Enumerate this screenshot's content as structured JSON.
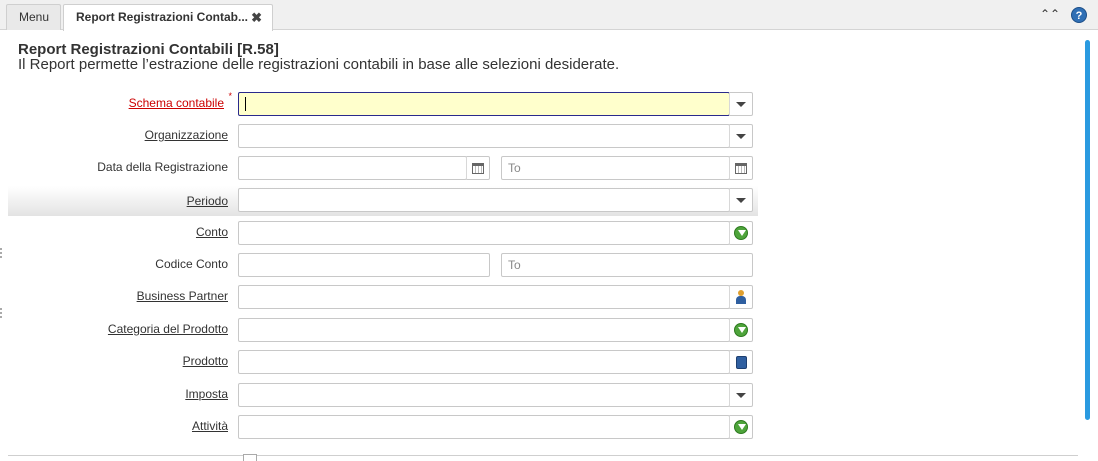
{
  "tabs": {
    "menu_label": "Menu",
    "active_label": "Report Registrazioni Contab...",
    "close_symbol": "✖"
  },
  "toolbar": {
    "collapse_symbol": "⌃⌃",
    "help_symbol": "?"
  },
  "page": {
    "title": "Report Registrazioni Contabili [R.58]",
    "description": "Il Report permette l’estrazione delle registrazioni contabili in base alle selezioni desiderate."
  },
  "fields": {
    "schema_contabile": {
      "label": "Schema contabile",
      "value": "",
      "icon": "dropdown-caret"
    },
    "organizzazione": {
      "label": "Organizzazione",
      "value": "",
      "icon": "dropdown-caret"
    },
    "data_registrazione": {
      "label": "Data della Registrazione",
      "from_value": "",
      "to_placeholder": "To",
      "icon": "calendar-icon"
    },
    "periodo": {
      "label": "Periodo",
      "value": "",
      "icon": "dropdown-caret"
    },
    "conto": {
      "label": "Conto",
      "value": "",
      "icon": "green-arrow-icon"
    },
    "codice_conto": {
      "label": "Codice Conto",
      "from_value": "",
      "to_placeholder": "To"
    },
    "business_partner": {
      "label": "Business Partner",
      "value": "",
      "icon": "person-icon"
    },
    "categoria_prodotto": {
      "label": "Categoria del Prodotto",
      "value": "",
      "icon": "green-arrow-icon"
    },
    "prodotto": {
      "label": "Prodotto",
      "value": "",
      "icon": "product-icon"
    },
    "imposta": {
      "label": "Imposta",
      "value": "",
      "icon": "dropdown-caret"
    },
    "attivita": {
      "label": "Attività",
      "value": "",
      "icon": "green-arrow-icon"
    }
  },
  "colors": {
    "mandatory_bg": "#ffffcc",
    "mandatory_label": "#cc0000",
    "scrollbar": "#2a9ae0"
  }
}
